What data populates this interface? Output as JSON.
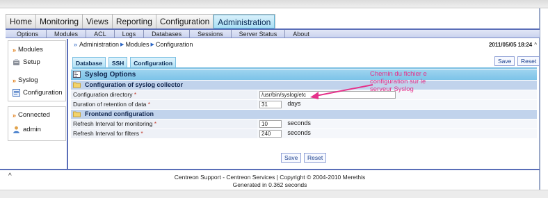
{
  "main_menu": {
    "items": [
      "Home",
      "Monitoring",
      "Views",
      "Reporting",
      "Configuration",
      "Administration"
    ],
    "active": "Administration"
  },
  "sub_menu": {
    "items": [
      "Options",
      "Modules",
      "ACL",
      "Logs",
      "Databases",
      "Sessions",
      "Server Status",
      "About"
    ]
  },
  "sidebar": {
    "modules_label": "Modules",
    "setup_label": "Setup",
    "syslog_label": "Syslog",
    "configuration_label": "Configuration",
    "connected_label": "Connected",
    "user_label": "admin"
  },
  "breadcrumb": {
    "items": [
      "Administration",
      "Modules",
      "Configuration"
    ]
  },
  "datetime": "2011/05/05 18:24",
  "tabs": {
    "items": [
      "Database",
      "SSH",
      "Configuration"
    ]
  },
  "buttons": {
    "save": "Save",
    "reset": "Reset"
  },
  "form": {
    "title": "Syslog Options",
    "collector_section": "Configuration of syslog collector",
    "config_dir_label": "Configuration directory",
    "config_dir_value": "/usr/bin/syslog/etc",
    "retention_label": "Duration of retention of data",
    "retention_value": "31",
    "retention_unit": "days",
    "frontend_section": "Frontend configuration",
    "refresh_monitoring_label": "Refresh Interval for monitoring",
    "refresh_monitoring_value": "10",
    "refresh_filters_label": "Refresh Interval for filters",
    "refresh_filters_value": "240",
    "seconds_unit": "seconds",
    "required_mark": "*"
  },
  "annotation": {
    "lines": [
      "Chemin du fichier e",
      "configuration sur le",
      "serveur Syslog"
    ]
  },
  "footer": {
    "line1": "Centreon Support - Centreon Services | Copyright © 2004-2010 Merethis",
    "line2": "Generated in 0.362 seconds"
  },
  "colors": {
    "accent": "#5a6eb8",
    "active_tab": "#a9dff4",
    "annotation": "#e5318a",
    "required": "#c0392b"
  }
}
